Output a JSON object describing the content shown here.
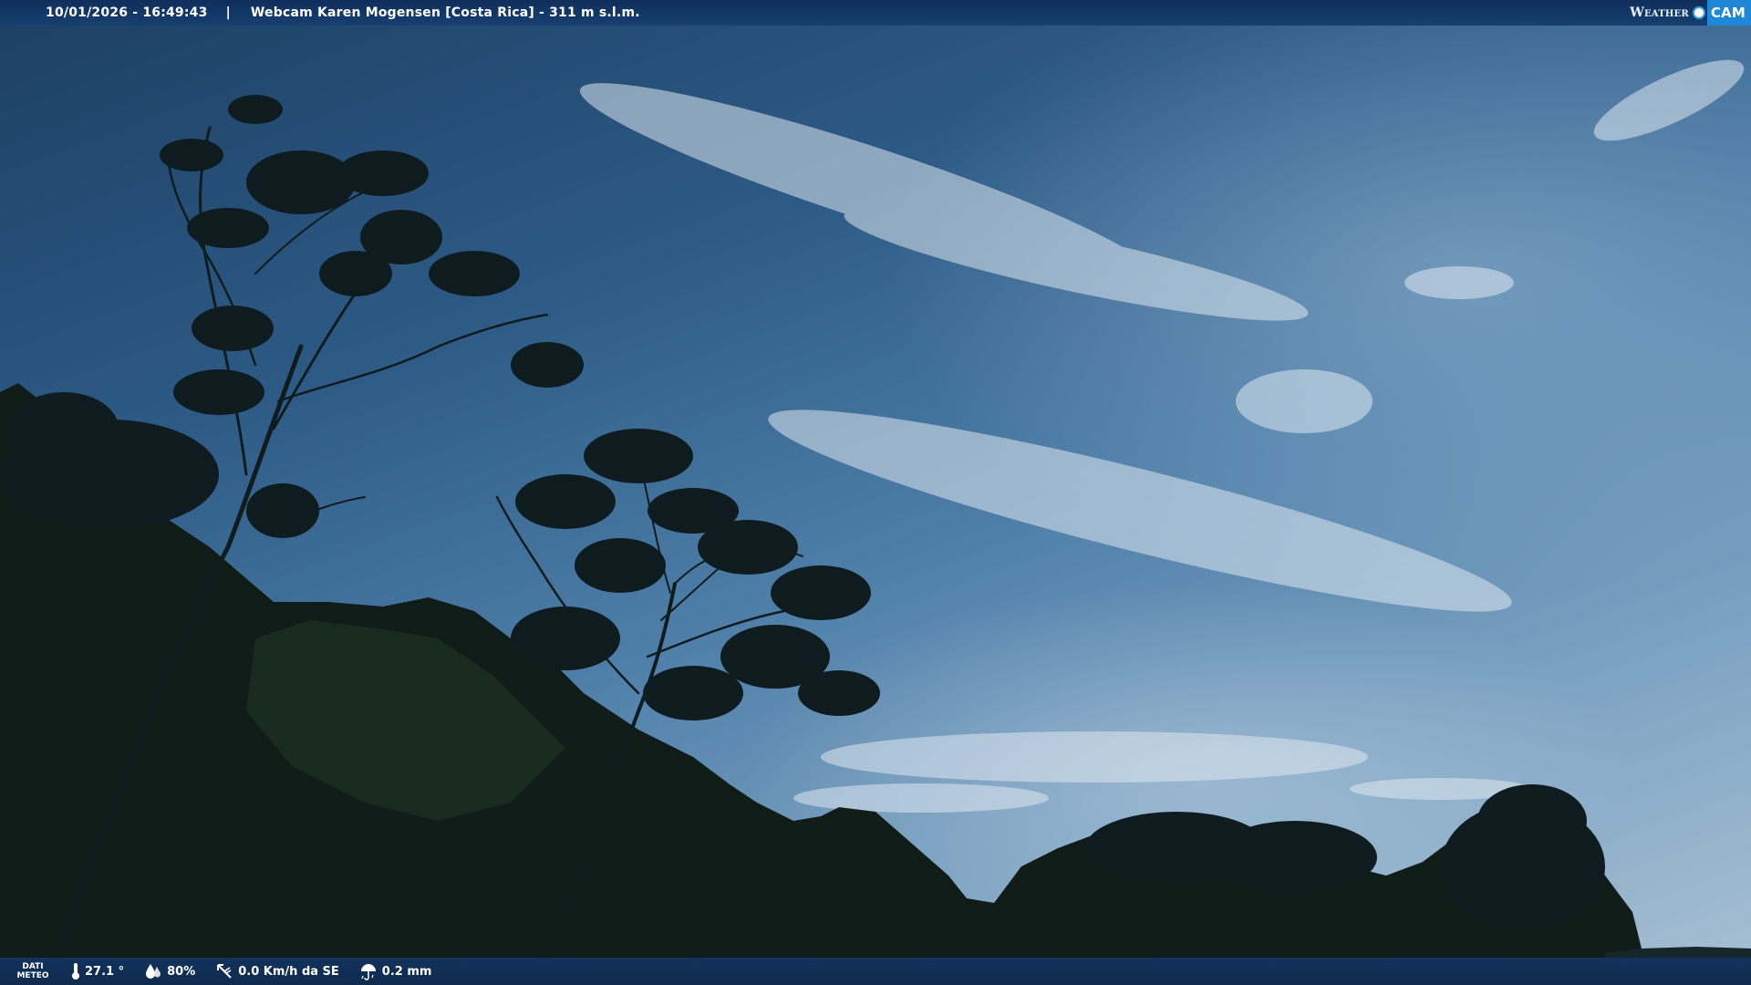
{
  "header": {
    "datetime": "10/01/2026 - 16:49:43",
    "separator": "|",
    "title": "Webcam Karen Mogensen [Costa Rica]  - 311 m s.l.m.",
    "brand_weather": "Weather",
    "brand_cam": "CAM"
  },
  "footer": {
    "label_line1": "DATI",
    "label_line2": "METEO",
    "temperature": "27.1 °",
    "humidity": "80%",
    "wind": "0.0 Km/h da SE",
    "rain": "0.2 mm"
  },
  "icons": [
    "thermometer-icon",
    "humidity-icon",
    "wind-icon",
    "rain-icon"
  ],
  "colors": {
    "bar": "#12335d",
    "brand_accent": "#1e88d6"
  }
}
